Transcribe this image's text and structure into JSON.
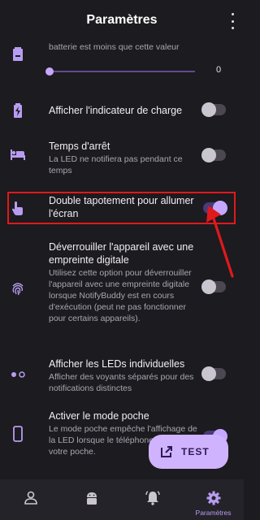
{
  "header": {
    "title": "Paramètres"
  },
  "battery_row": {
    "partial_text": "batterie est moins que cette valeur",
    "slider_value": "0",
    "slider_fraction": 0
  },
  "rows": [
    {
      "title": "Afficher l'indicateur de charge",
      "subtitle": "",
      "toggle_on": false,
      "icon": "charging-battery-icon"
    },
    {
      "title": "Temps d'arrêt",
      "subtitle": "La LED ne notifiera pas pendant ce temps",
      "toggle_on": false,
      "icon": "bed-icon"
    },
    {
      "title": "Double tapotement pour allumer l'écran",
      "subtitle": "",
      "toggle_on": true,
      "icon": "tap-hand-icon"
    },
    {
      "title": "Déverrouiller l'appareil avec une empreinte digitale",
      "subtitle": "Utilisez cette option pour déverrouiller l'appareil avec une empreinte digitale lorsque NotifyBuddy est en cours d'exécution (peut ne pas fonctionner pour certains appareils).",
      "toggle_on": false,
      "icon": "fingerprint-icon"
    },
    {
      "title": "Afficher les LEDs individuelles",
      "subtitle": "Afficher des voyants séparés pour des notifications distinctes",
      "toggle_on": false,
      "icon": "dots-icon"
    },
    {
      "title": "Activer le mode poche",
      "subtitle": "Le mode poche empêche l'affichage de la LED lorsque le téléphone est dans votre poche.",
      "toggle_on": true,
      "icon": "phone-icon"
    }
  ],
  "fab": {
    "label": "TEST",
    "icon": "open-in-new-icon"
  },
  "nav": {
    "items": [
      {
        "label": "",
        "icon": "person-icon",
        "active": false
      },
      {
        "label": "",
        "icon": "android-icon",
        "active": false
      },
      {
        "label": "",
        "icon": "bell-icon",
        "active": false
      },
      {
        "label": "Paramètres",
        "icon": "settings-gear-icon",
        "active": true
      }
    ]
  },
  "colors": {
    "accent": "#c6a7ff",
    "background": "#1c1b1f",
    "highlight": "#e0191d",
    "fab": "#d0b3ff"
  }
}
